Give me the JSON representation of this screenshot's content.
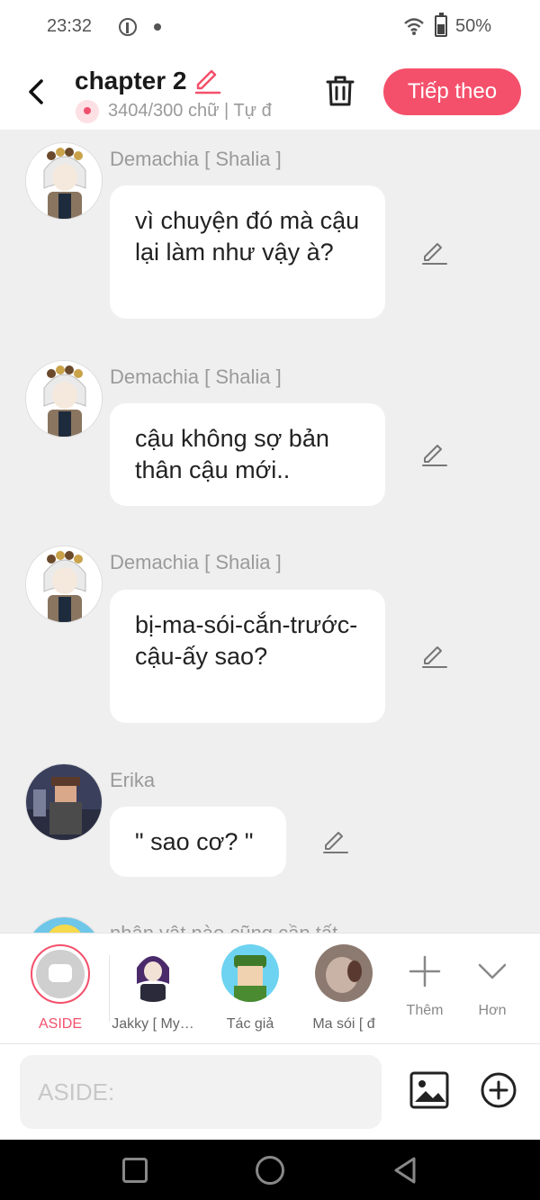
{
  "status": {
    "time": "23:32",
    "battery": "50%"
  },
  "header": {
    "title": "chapter 2",
    "word_count": "3404/300 chữ | Tự đ",
    "next_label": "Tiếp theo"
  },
  "messages": [
    {
      "sender": "Demachia [ Shalia ]",
      "text": "vì chuyện đó mà cậu lại làm như vậy à?"
    },
    {
      "sender": "Demachia [ Shalia ]",
      "text": "cậu không sợ bản thân cậu mới.."
    },
    {
      "sender": "Demachia [ Shalia ]",
      "text": "bị-ma-sói-cắn-trước-cậu-ấy sao?"
    },
    {
      "sender": "Erika",
      "text": "\" sao cơ? \""
    },
    {
      "sender": "nhân vật nào cũng cần tất"
    }
  ],
  "characters": [
    {
      "label": "ASIDE"
    },
    {
      "label": "Jakky [ My…"
    },
    {
      "label": "Tác giả"
    },
    {
      "label": "Ma sói [ đ"
    }
  ],
  "tools": {
    "more_label": "Thêm",
    "expand_label": "Hơn"
  },
  "input": {
    "placeholder": "ASIDE:"
  },
  "colors": {
    "accent": "#f4506b",
    "background": "#efefef",
    "bubble": "#ffffff"
  }
}
